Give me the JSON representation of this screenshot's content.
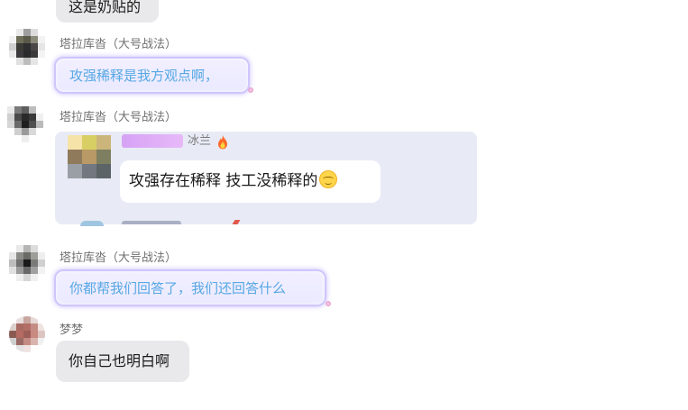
{
  "messages": [
    {
      "text": "这是奶贴的"
    },
    {
      "sender": "塔拉库沓（大号战法）",
      "text": "攻强稀释是我方观点啊，"
    },
    {
      "sender": "塔拉库沓（大号战法）",
      "quoted": {
        "author": "冰兰",
        "author_icon": "fire-icon",
        "text": "攻强存在稀释  技工没稀释的",
        "emoji": "smiling-face-icon"
      }
    },
    {
      "sender": "塔拉库沓（大号战法）",
      "text": "你都帮我们回答了，我们还回答什么"
    },
    {
      "sender": "梦梦",
      "text": "你自己也明白啊"
    }
  ],
  "colors": {
    "grey_bubble": "#e9e9eb",
    "theme_bubble_text": "#57a8e4",
    "theme_bubble_glow": "#cfc6fb",
    "reply_card": "#e8ebf6",
    "name_tag": "#d6a2f5"
  }
}
